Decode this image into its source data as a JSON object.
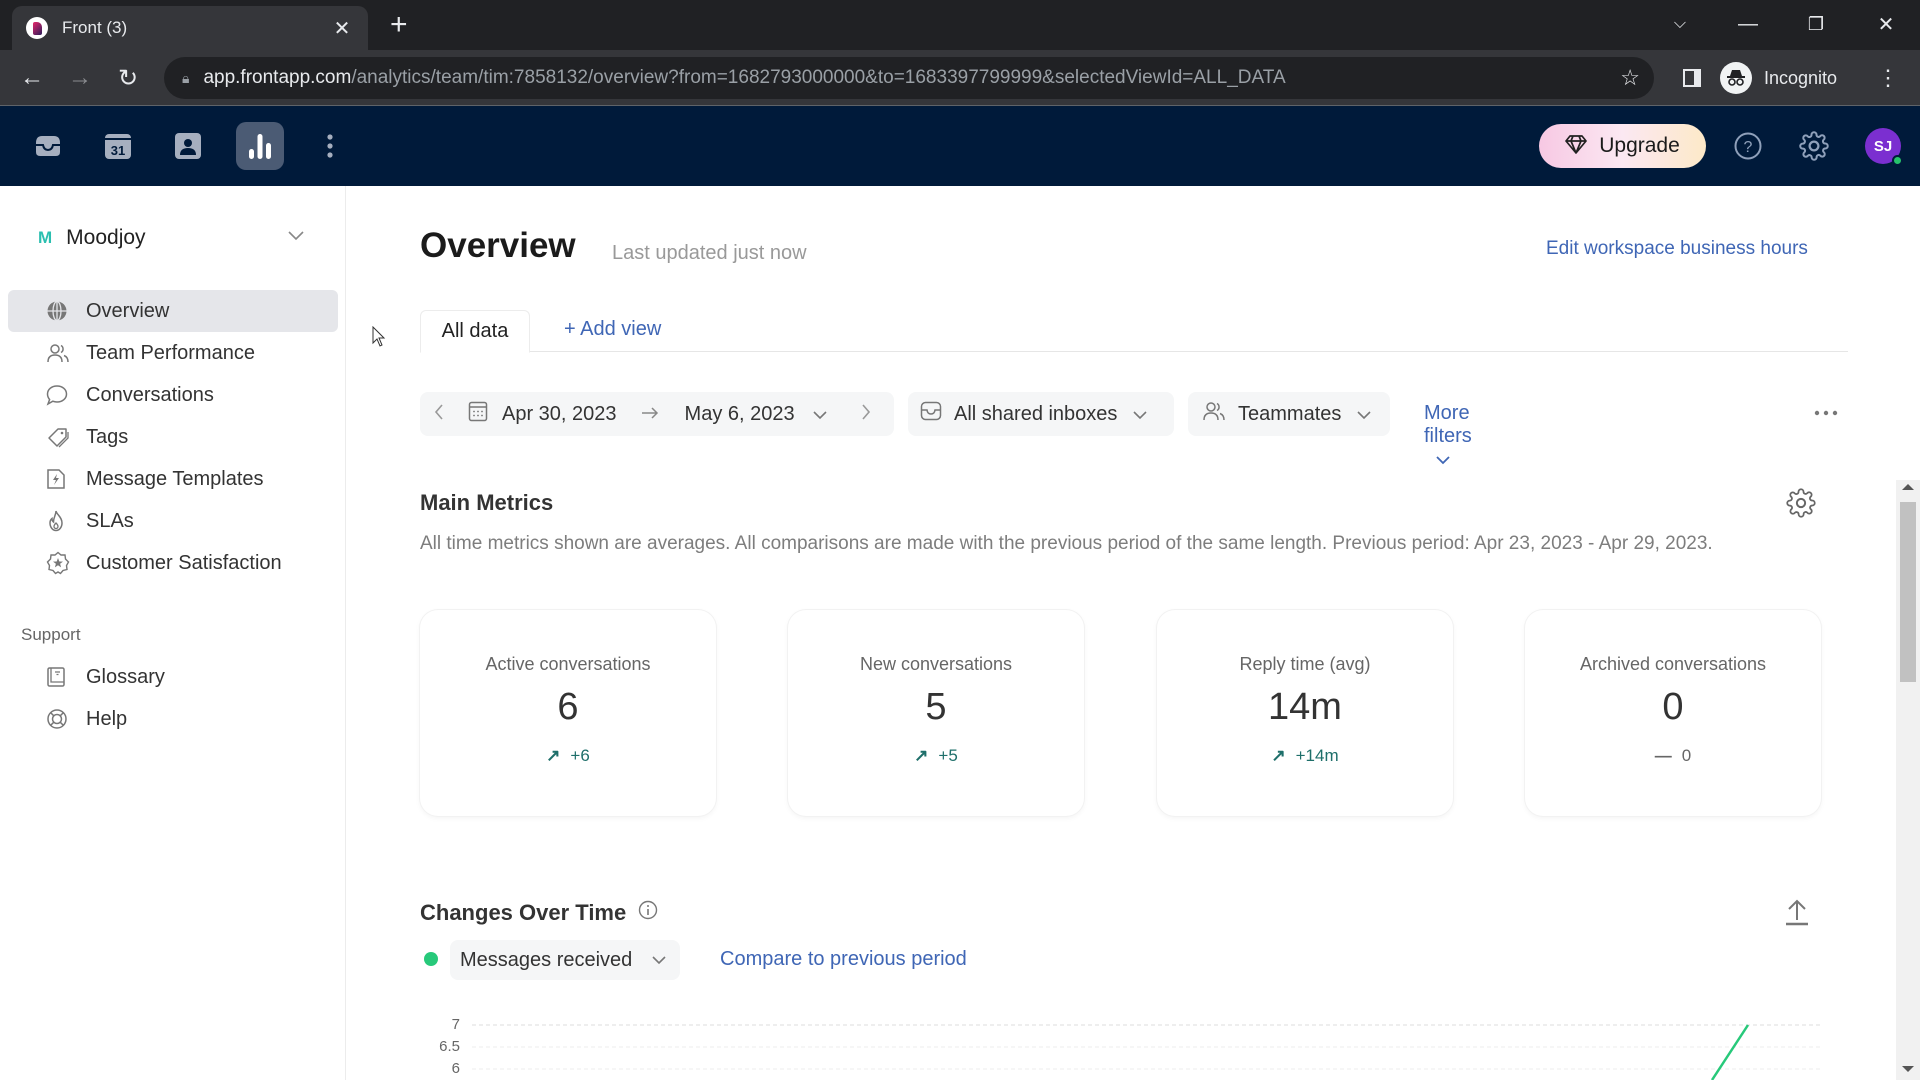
{
  "browser": {
    "tab_title": "Front (3)",
    "url_host": "app.frontapp.com",
    "url_path": "/analytics/team/tim:7858132/overview?from=1682793000000&to=1683397799999&selectedViewId=ALL_DATA",
    "profile_label": "Incognito"
  },
  "appbar": {
    "icons": [
      "inbox-icon",
      "calendar-icon",
      "contacts-icon",
      "analytics-icon",
      "more-icon"
    ],
    "calendar_day": "31",
    "upgrade_label": "Upgrade",
    "avatar_initials": "SJ",
    "colors": {
      "background": "#001a3a",
      "avatar": "#7b2fd0",
      "online": "#27c26b"
    }
  },
  "sidebar": {
    "workspace_initial": "M",
    "workspace_name": "Moodjoy",
    "items": [
      {
        "label": "Overview",
        "icon": "globe-icon",
        "active": true
      },
      {
        "label": "Team Performance",
        "icon": "team-icon"
      },
      {
        "label": "Conversations",
        "icon": "chat-bubble-icon"
      },
      {
        "label": "Tags",
        "icon": "tag-icon"
      },
      {
        "label": "Message Templates",
        "icon": "template-icon"
      },
      {
        "label": "SLAs",
        "icon": "flame-icon"
      },
      {
        "label": "Customer Satisfaction",
        "icon": "star-badge-icon"
      }
    ],
    "support_label": "Support",
    "support_items": [
      {
        "label": "Glossary",
        "icon": "book-icon"
      },
      {
        "label": "Help",
        "icon": "lifebuoy-icon"
      }
    ]
  },
  "main": {
    "title": "Overview",
    "last_updated": "Last updated just now",
    "edit_hours_link": "Edit workspace business hours",
    "tabs": [
      {
        "label": "All data",
        "active": true
      }
    ],
    "add_view_label": "+ Add view",
    "filters": {
      "date_from": "Apr 30, 2023",
      "date_to": "May 6, 2023",
      "inboxes": "All shared inboxes",
      "teammates": "Teammates",
      "more_filters": "More filters"
    },
    "main_metrics": {
      "title": "Main Metrics",
      "description": "All time metrics shown are averages. All comparisons are made with the previous period of the same length. Previous period: Apr 23, 2023 - Apr 29, 2023.",
      "cards": [
        {
          "label": "Active conversations",
          "value": "6",
          "change": "+6",
          "trend": "up"
        },
        {
          "label": "New conversations",
          "value": "5",
          "change": "+5",
          "trend": "up"
        },
        {
          "label": "Reply time (avg)",
          "value": "14m",
          "change": "+14m",
          "trend": "up"
        },
        {
          "label": "Archived conversations",
          "value": "0",
          "change": "0",
          "trend": "flat"
        }
      ]
    },
    "changes_over_time": {
      "title": "Changes Over Time",
      "metric": "Messages received",
      "compare_label": "Compare to previous period",
      "series_color": "#27c97a",
      "y_ticks": [
        "7",
        "6.5",
        "6"
      ]
    }
  }
}
